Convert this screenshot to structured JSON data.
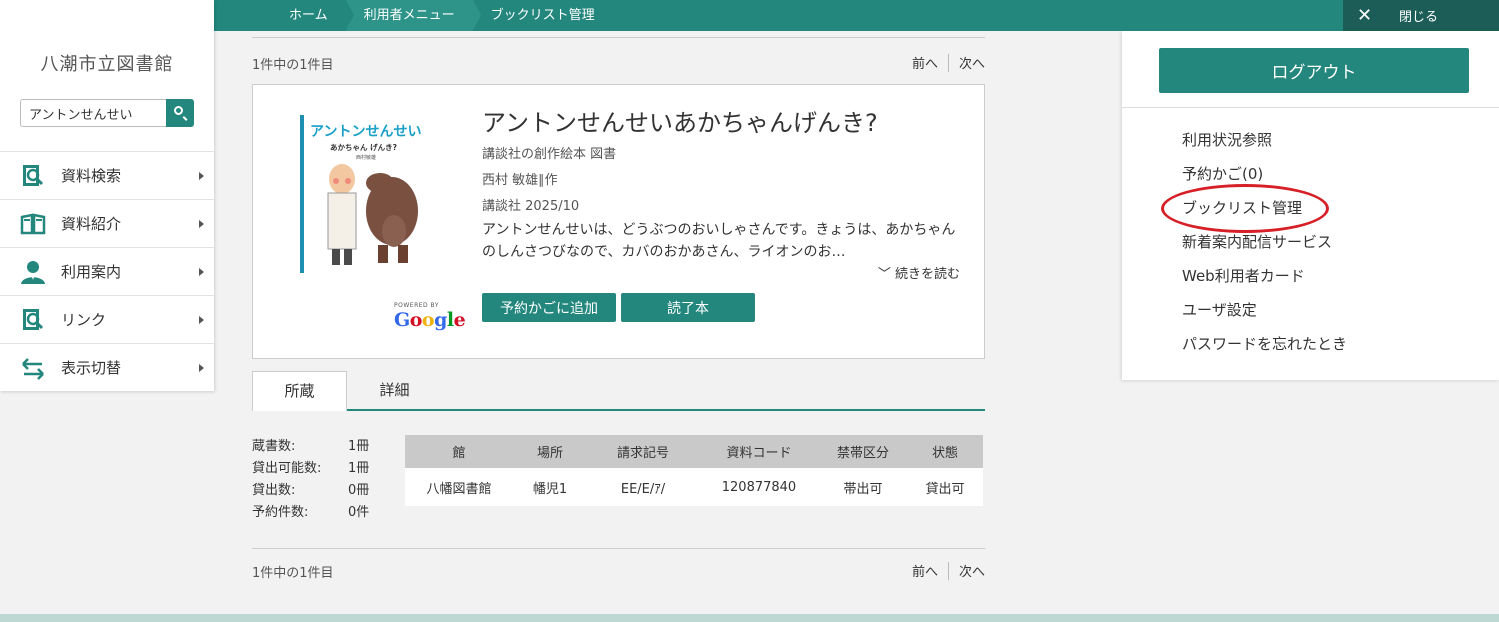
{
  "breadcrumb": {
    "items": [
      "ホーム",
      "利用者メニュー",
      "ブックリスト管理"
    ]
  },
  "close_label": "閉じる",
  "library_name": "八潮市立図書館",
  "search": {
    "value": "アントンせんせい"
  },
  "nav": {
    "items": [
      {
        "label": "資料検索",
        "icon": "book-search-icon"
      },
      {
        "label": "資料紹介",
        "icon": "open-book-icon"
      },
      {
        "label": "利用案内",
        "icon": "person-icon"
      },
      {
        "label": "リンク",
        "icon": "link-search-icon"
      },
      {
        "label": "表示切替",
        "icon": "switch-arrows-icon"
      }
    ]
  },
  "results": {
    "count_text": "1件中の1件目",
    "prev": "前へ",
    "next": "次へ"
  },
  "book": {
    "cover_title": "アントンせんせい",
    "cover_subtitle": "あかちゃん げんき?",
    "cover_author": "西村敏雄",
    "powered_by": "POWERED BY",
    "google": [
      "G",
      "o",
      "o",
      "g",
      "l",
      "e"
    ],
    "title": "アントンせんせいあかちゃんげんき?",
    "series": "講談社の創作絵本 図書",
    "author": "西村 敏雄∥作",
    "publisher": "講談社 2025/10",
    "description": "アントンせんせいは、どうぶつのおいしゃさんです。きょうは、あかちゃんのしんさつびなので、カバのおかあさん、ライオンのお…",
    "read_more": "続きを読む",
    "reserve_button": "予約かごに追加",
    "read_button": "読了本"
  },
  "tabs": [
    "所蔵",
    "詳細"
  ],
  "stats": [
    {
      "label": "蔵書数:",
      "value": "1冊"
    },
    {
      "label": "貸出可能数:",
      "value": "1冊"
    },
    {
      "label": "貸出数:",
      "value": "0冊"
    },
    {
      "label": "予約件数:",
      "value": "0件"
    }
  ],
  "holdings": {
    "headers": [
      "館",
      "場所",
      "請求記号",
      "資料コード",
      "禁帯区分",
      "状態"
    ],
    "rows": [
      [
        "八幡図書館",
        "幡児1",
        "EE/E/ｱ/",
        "120877840",
        "帯出可",
        "貸出可"
      ]
    ]
  },
  "right_panel": {
    "logout": "ログアウト",
    "menu": [
      "利用状況参照",
      "予約かご(0)",
      "ブックリスト管理",
      "新着案内配信サービス",
      "Web利用者カード",
      "ユーザ設定",
      "パスワードを忘れたとき"
    ]
  },
  "colors": {
    "accent": "#23877d",
    "dark_accent": "#1c5e57",
    "highlight_circle": "#d61f26"
  }
}
